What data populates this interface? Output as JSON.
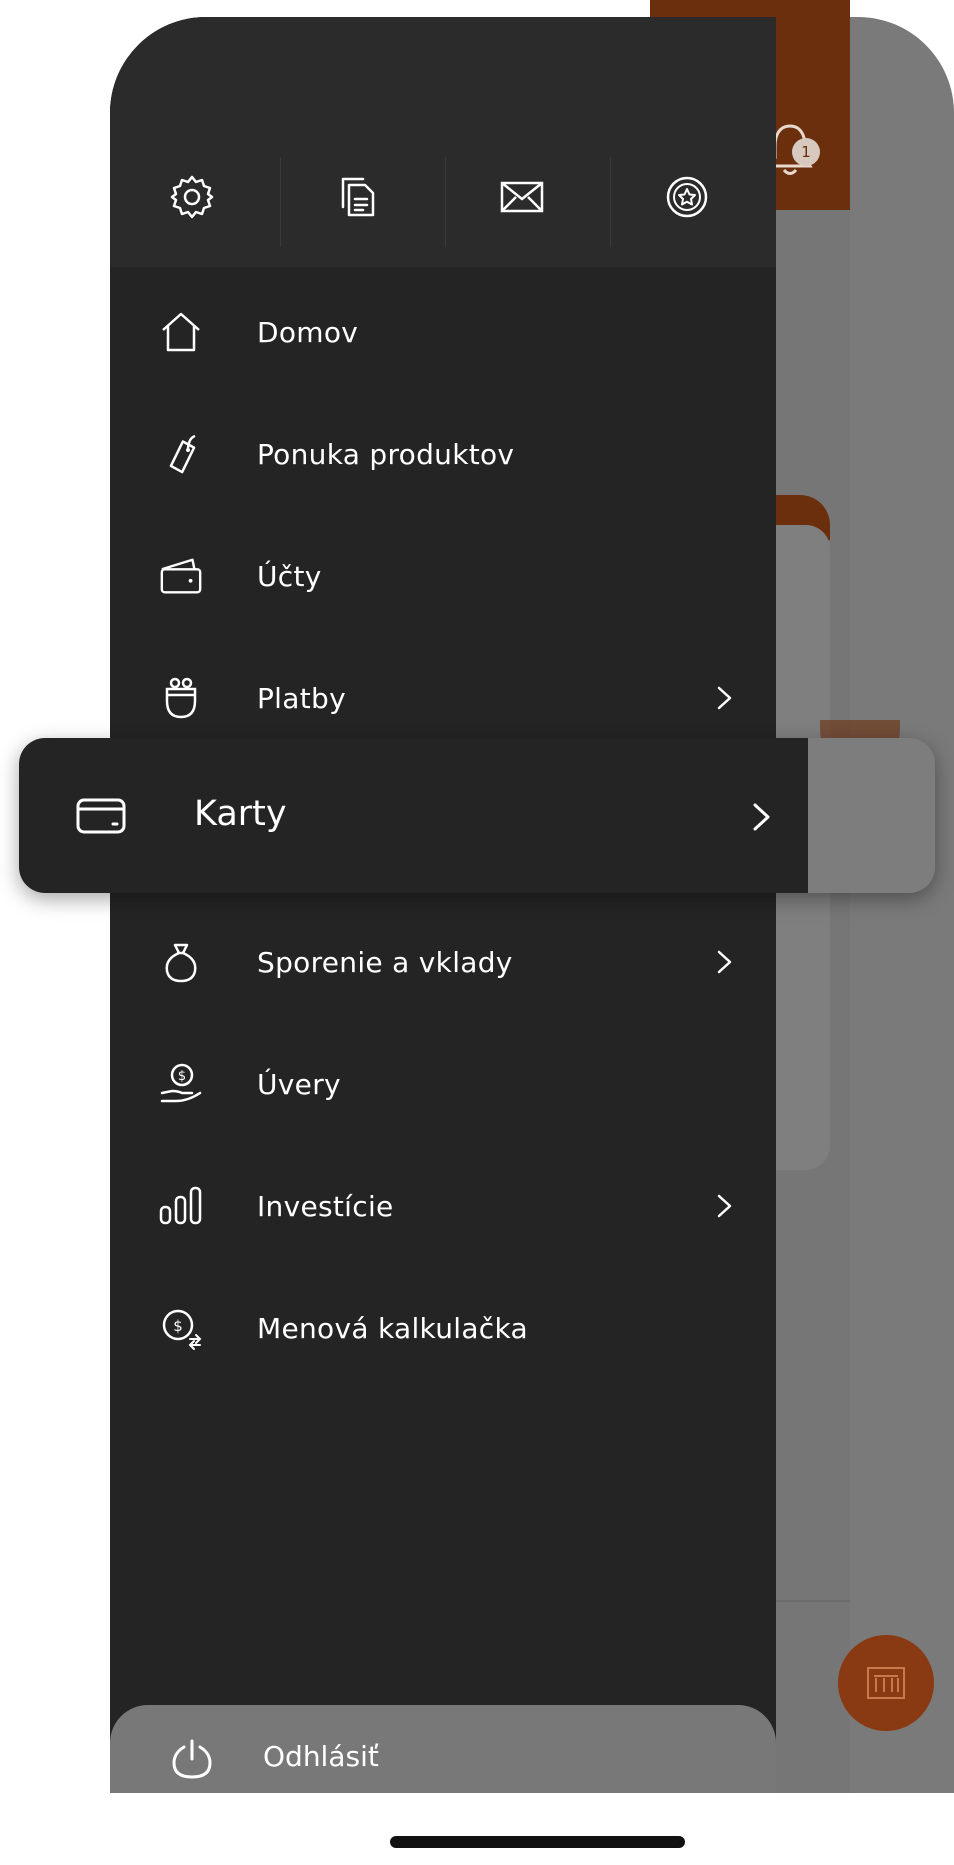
{
  "toolbar": {
    "items": [
      {
        "icon": "gear-icon"
      },
      {
        "icon": "documents-icon"
      },
      {
        "icon": "mail-icon"
      },
      {
        "icon": "star-badge-icon"
      }
    ]
  },
  "menu": {
    "items": [
      {
        "label": "Domov",
        "icon": "home-icon",
        "has_submenu": false
      },
      {
        "label": "Ponuka produktov",
        "icon": "tag-icon",
        "has_submenu": false
      },
      {
        "label": "Účty",
        "icon": "wallet-icon",
        "has_submenu": false
      },
      {
        "label": "Platby",
        "icon": "payments-icon",
        "has_submenu": true
      },
      {
        "label": "Karty",
        "icon": "card-icon",
        "has_submenu": true,
        "highlighted": true
      },
      {
        "label": "Sporenie a vklady",
        "icon": "piggy-bag-icon",
        "has_submenu": true
      },
      {
        "label": "Úvery",
        "icon": "loan-hand-icon",
        "has_submenu": false
      },
      {
        "label": "Investície",
        "icon": "investments-icon",
        "has_submenu": true
      },
      {
        "label": "Menová kalkulačka",
        "icon": "currency-exchange-icon",
        "has_submenu": false
      }
    ]
  },
  "logout": {
    "label": "Odhlásiť",
    "icon": "power-icon"
  },
  "background": {
    "notification_count": "1",
    "accent": "#6b2f0d"
  },
  "colors": {
    "drawer": "#242424",
    "drawer_top": "#2b2b2b",
    "text": "#ffffff"
  }
}
